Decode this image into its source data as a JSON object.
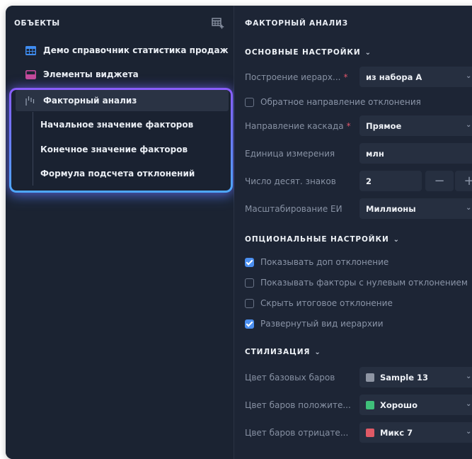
{
  "objects_panel": {
    "title": "ОБЪЕКТЫ",
    "items": [
      {
        "label": "Демо справочник статистика продаж",
        "icon": "table-icon"
      },
      {
        "label": "Элементы виджета",
        "icon": "widget-elements-icon"
      },
      {
        "label": "Факторный анализ",
        "icon": "waterfall-chart-icon"
      }
    ],
    "children": [
      {
        "label": "Начальное значение факторов"
      },
      {
        "label": "Конечное значение факторов"
      },
      {
        "label": "Формула подсчета отклонений"
      }
    ]
  },
  "settings_panel": {
    "title": "ФАКТОРНЫЙ АНАЛИЗ",
    "basic": {
      "heading": "ОСНОВНЫЕ НАСТРОЙКИ",
      "hierarchy_label": "Построение иерарх...",
      "hierarchy_value": "из набора А",
      "reverse_label": "Обратное направление отклонения",
      "reverse_checked": false,
      "cascade_label": "Направление каскада",
      "cascade_value": "Прямое",
      "unit_label": "Единица измерения",
      "unit_value": "млн",
      "decimals_label": "Число десят. знаков",
      "decimals_value": "2",
      "minus_symbol": "−",
      "plus_symbol": "+",
      "scale_label": "Масштабирование ЕИ",
      "scale_value": "Миллионы"
    },
    "optional": {
      "heading": "ОПЦИОНАЛЬНЫЕ НАСТРОЙКИ",
      "options": [
        {
          "label": "Показывать доп отклонение",
          "checked": true
        },
        {
          "label": "Показывать факторы с нулевым отклонением",
          "checked": false
        },
        {
          "label": "Скрыть итоговое отклонение",
          "checked": false
        },
        {
          "label": "Развернутый вид иерархии",
          "checked": true
        }
      ]
    },
    "styling": {
      "heading": "СТИЛИЗАЦИЯ",
      "rows": [
        {
          "label": "Цвет базовых баров",
          "value": "Sample 13",
          "color": "#8e95a3"
        },
        {
          "label": "Цвет баров положите...",
          "value": "Хорошо",
          "color": "#3fc07a"
        },
        {
          "label": "Цвет баров отрицате...",
          "value": "Микс 7",
          "color": "#e05a66"
        }
      ]
    }
  },
  "colors": {
    "accent": "#4b8ff0",
    "highlight": "#7b61ff",
    "required": "#e0556a"
  }
}
